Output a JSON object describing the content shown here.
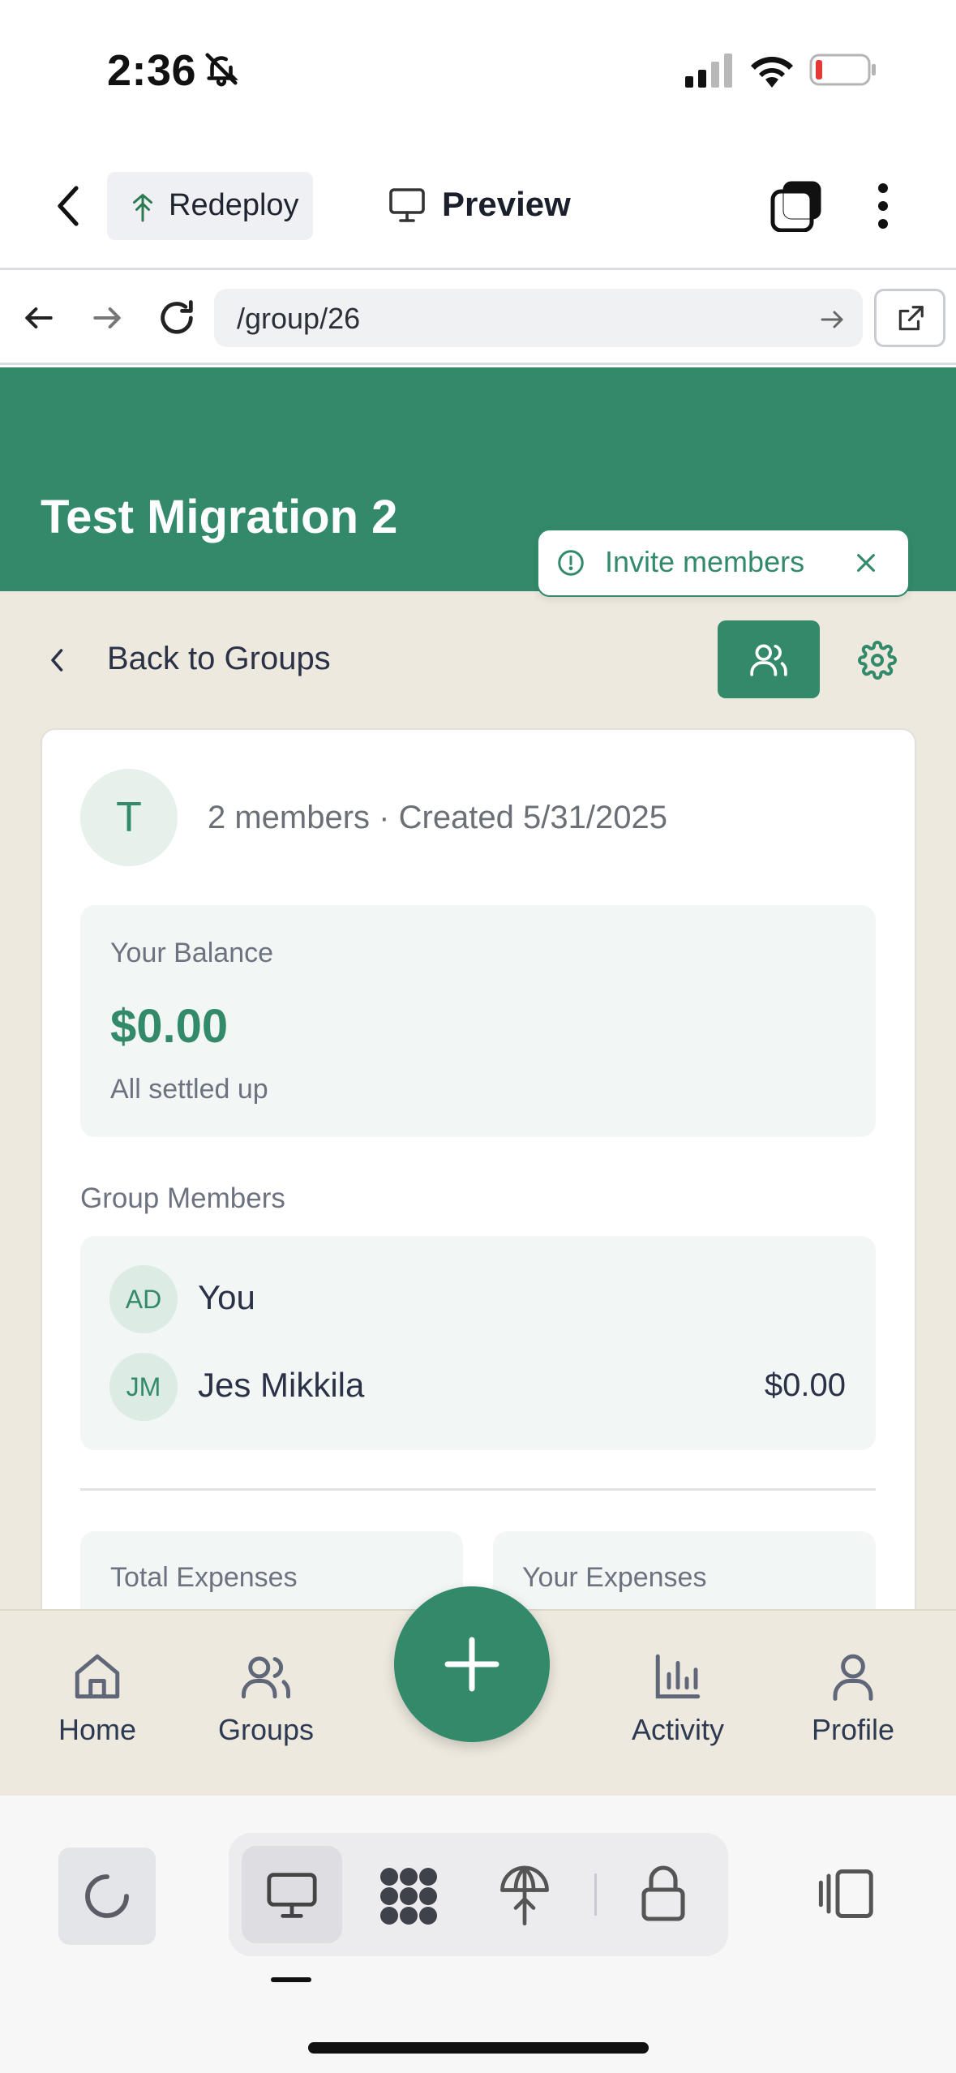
{
  "status_bar": {
    "time": "2:36"
  },
  "top_bar": {
    "redeploy_label": "Redeploy",
    "preview_label": "Preview"
  },
  "browser": {
    "url": "/group/26"
  },
  "group": {
    "title": "Test Migration 2",
    "avatar_letter": "T",
    "meta": "2 members · Created 5/31/2025"
  },
  "toast": {
    "label": "Invite members"
  },
  "nav": {
    "back_label": "Back to Groups"
  },
  "balance": {
    "label": "Your Balance",
    "amount": "$0.00",
    "status": "All settled up"
  },
  "members": {
    "heading": "Group Members",
    "items": [
      {
        "initials": "AD",
        "name": "You",
        "amount": ""
      },
      {
        "initials": "JM",
        "name": "Jes Mikkila",
        "amount": "$0.00"
      }
    ]
  },
  "stats": {
    "total_label": "Total Expenses",
    "yours_label": "Your Expenses"
  },
  "bottom_nav": {
    "home": "Home",
    "groups": "Groups",
    "activity": "Activity",
    "profile": "Profile"
  },
  "colors": {
    "brand": "#338a6a",
    "background": "#ede9df",
    "text": "#2b3247"
  },
  "icons": [
    "bell-slash-icon",
    "signal-icon",
    "wifi-icon",
    "battery-icon",
    "chevron-left-icon",
    "tree-icon",
    "monitor-icon",
    "stack-icon",
    "more-vertical-icon",
    "arrow-left-icon",
    "arrow-right-icon",
    "reload-icon",
    "external-link-icon",
    "info-circle-icon",
    "close-icon",
    "users-icon",
    "gear-icon",
    "home-icon",
    "plus-icon",
    "bar-chart-icon",
    "user-icon",
    "spinner-icon",
    "grid-icon",
    "lock-icon",
    "sidebar-icon"
  ]
}
